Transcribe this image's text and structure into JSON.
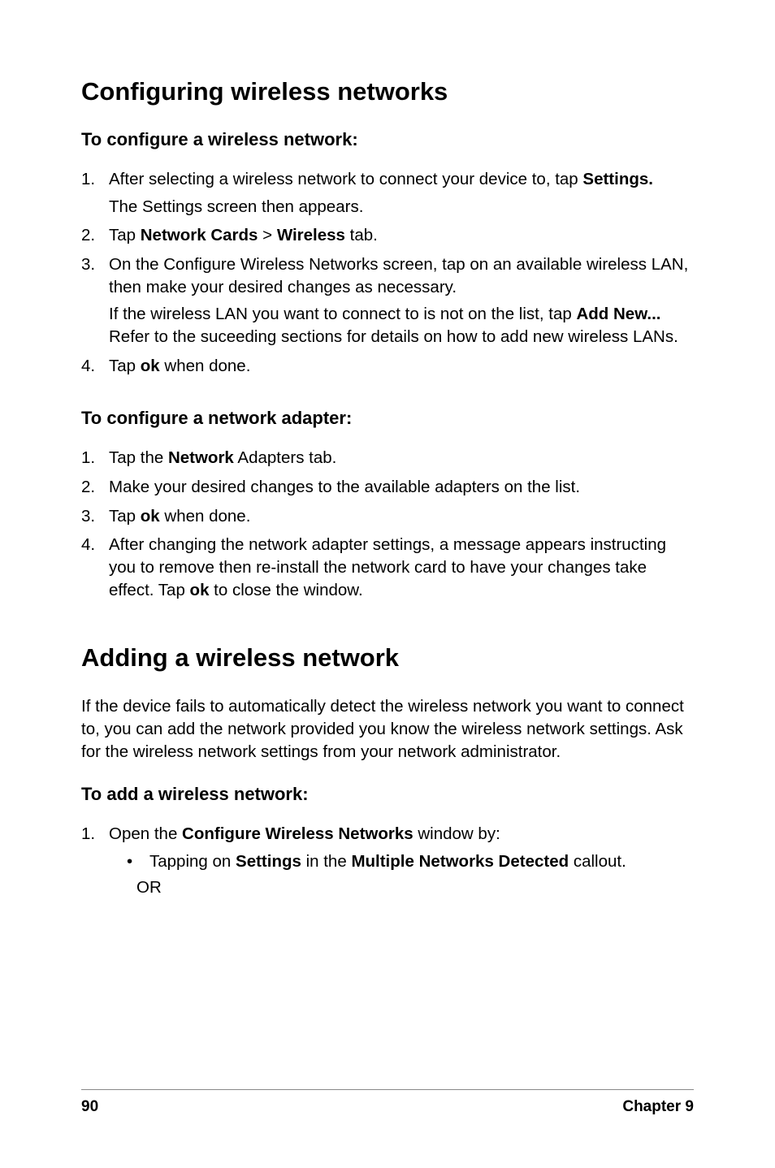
{
  "h1_a": "Configuring wireless networks",
  "h2_a": "To configure a wireless network:",
  "list_a": {
    "i1_pre": "After selecting a wireless network to connect your device to, tap ",
    "i1_b": "Settings.",
    "i1_sub": "The Settings screen then appears.",
    "i2_pre": "Tap ",
    "i2_b1": "Network Cards",
    "i2_mid": " > ",
    "i2_b2": "Wireless",
    "i2_post": " tab.",
    "i3_p1": "On the Configure Wireless Networks screen, tap on an available wireless LAN, then make your desired changes as necessary.",
    "i3_p2_pre": "If the wireless LAN you want to connect to is not on the list, tap ",
    "i3_p2_b": "Add New...",
    "i3_p2_post": " Refer to the suceeding sections for details on how to add new wireless LANs.",
    "i4_pre": "Tap ",
    "i4_b": "ok",
    "i4_post": " when done."
  },
  "h2_b": "To configure a network adapter:",
  "list_b": {
    "i1_pre": "Tap the ",
    "i1_b": "Network",
    "i1_post": " Adapters tab.",
    "i2": "Make your desired changes to the available adapters on the list.",
    "i3_pre": "Tap ",
    "i3_b": "ok",
    "i3_post": " when done.",
    "i4_pre": "After changing the network adapter settings, a message appears instructing you to remove then re-install the network card to have your changes take effect. Tap ",
    "i4_b": "ok",
    "i4_post": " to close the window."
  },
  "h1_b": "Adding a wireless network",
  "intro": "If the device fails to automatically detect the wireless network you want to connect to, you can add the network provided you know the wireless network settings. Ask for the wireless network settings from your network administrator.",
  "h2_c": "To add a wireless network:",
  "list_c": {
    "i1_pre": "Open the ",
    "i1_b": "Configure Wireless Networks",
    "i1_post": " window by:",
    "bullet_pre": "Tapping on ",
    "bullet_b1": "Settings",
    "bullet_mid": " in the ",
    "bullet_b2": "Multiple Networks Detected",
    "bullet_post": " callout.",
    "or": "OR"
  },
  "footer": {
    "page": "90",
    "chapter": "Chapter 9"
  }
}
